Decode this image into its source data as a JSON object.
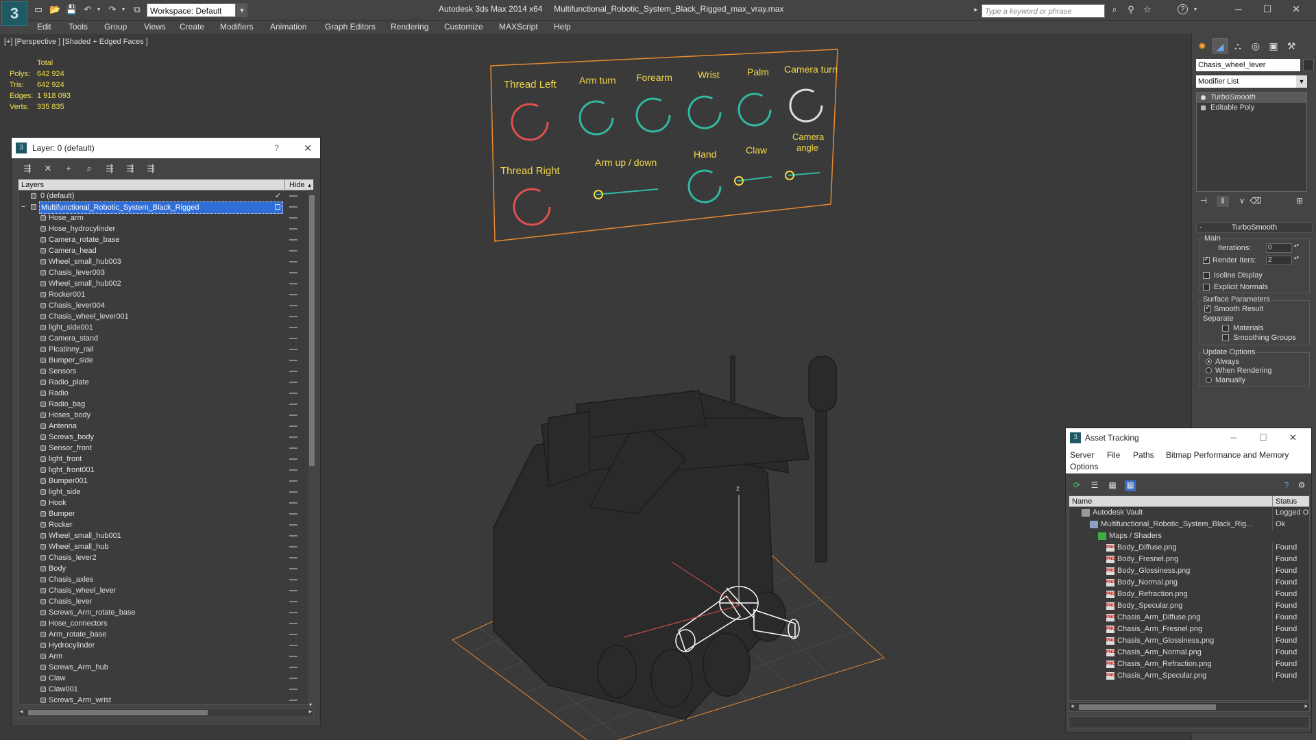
{
  "app": {
    "title": "Autodesk 3ds Max 2014 x64",
    "filename": "Multifunctional_Robotic_System_Black_Rigged_max_vray.max",
    "workspace": "Workspace: Default",
    "search_placeholder": "Type a keyword or phrase",
    "logo_glyph": "3"
  },
  "menu": [
    "Edit",
    "Tools",
    "Group",
    "Views",
    "Create",
    "Modifiers",
    "Animation",
    "Graph Editors",
    "Rendering",
    "Customize",
    "MAXScript",
    "Help"
  ],
  "viewport": {
    "label": "[+] [Perspective ] [Shaded + Edged Faces ]",
    "stats": {
      "header": "Total",
      "rows": [
        {
          "k": "Polys:",
          "v": "642 924"
        },
        {
          "k": "Tris:",
          "v": "642 924"
        },
        {
          "k": "Edges:",
          "v": "1 918 093"
        },
        {
          "k": "Verts:",
          "v": "335 835"
        }
      ]
    },
    "panel_labels": {
      "thread_left": "Thread Left",
      "arm_turn": "Arm turn",
      "forearm": "Forearm",
      "wrist": "Wrist",
      "palm": "Palm",
      "camera_turn": "Camera turn",
      "thread_right": "Thread Right",
      "arm_up_down": "Arm up / down",
      "hand": "Hand",
      "claw": "Claw",
      "camera_angle_1": "Camera",
      "camera_angle_2": "angle"
    },
    "axis_z": "z",
    "accent_red": "#e05050",
    "accent_teal": "#30b8a0",
    "accent_yellow": "#f2d84a",
    "accent_orange": "#e88a30"
  },
  "layer_dialog": {
    "title": "Layer: 0 (default)",
    "help": "?",
    "close": "✕",
    "col_layers": "Layers",
    "col_hide": "Hide",
    "col_hide_arrow": "▲",
    "tools": [
      "⇶",
      "✕",
      "+",
      "⌕",
      "⇶",
      "⇶",
      "⇶"
    ],
    "default_layer": "0 (default)",
    "selected_layer": "Multifunctional_Robotic_System_Black_Rigged",
    "checkmark": "✓",
    "expand": "−",
    "items": [
      "Hose_arm",
      "Hose_hydrocylinder",
      "Camera_rotate_base",
      "Camera_head",
      "Wheel_small_hub003",
      "Chasis_lever003",
      "Wheel_small_hub002",
      "Rocker001",
      "Chasis_lever004",
      "Chasis_wheel_lever001",
      "light_side001",
      "Camera_stand",
      "Picatinny_rail",
      "Bumper_side",
      "Sensors",
      "Radio_plate",
      "Radio",
      "Radio_bag",
      "Hoses_body",
      "Antenna",
      "Screws_body",
      "Sensor_front",
      "light_front",
      "light_front001",
      "Bumper001",
      "light_side",
      "Hook",
      "Bumper",
      "Rocker",
      "Wheel_small_hub001",
      "Wheel_small_hub",
      "Chasis_lever2",
      "Body",
      "Chasis_axles",
      "Chasis_wheel_lever",
      "Chasis_lever",
      "Screws_Arm_rotate_base",
      "Hose_connectors",
      "Arm_rotate_base",
      "Hydrocylinder",
      "Arm",
      "Screws_Arm_hub",
      "Claw",
      "Claw001",
      "Screws_Arm_wrist"
    ],
    "scroll_left": "◂",
    "scroll_right": "▸",
    "scroll_down": "▾",
    "scroll_up": "▴"
  },
  "command_panel": {
    "tabs": [
      "✹",
      "◢",
      "⛬",
      "◎",
      "▣",
      "⚒"
    ],
    "object_name": "Chasis_wheel_lever",
    "modifier_list": "Modifier List",
    "dropdown_arrow": "▼",
    "stack": [
      "TurboSmooth",
      "Editable Poly"
    ],
    "stack_tools": [
      "⊣",
      "‖",
      "⋎",
      "⌫",
      "⊞"
    ],
    "rollout_title": "TurboSmooth",
    "rollout_toggle": "-",
    "main": "Main",
    "iterations_label": "Iterations:",
    "iterations_value": "0",
    "render_iters_label": "Render Iters:",
    "render_iters_value": "2",
    "isoline": "Isoline Display",
    "explicit_normals": "Explicit Normals",
    "surface_params": "Surface Parameters",
    "smooth_result": "Smooth Result",
    "separate": "Separate",
    "materials": "Materials",
    "smoothing_groups": "Smoothing Groups",
    "update_options": "Update Options",
    "always": "Always",
    "when_rendering": "When Rendering",
    "manually": "Manually"
  },
  "asset_tracking": {
    "title": "Asset Tracking",
    "minimize": "─",
    "maximize": "☐",
    "close": "✕",
    "menu": [
      "Server",
      "File",
      "Paths",
      "Bitmap Performance and Memory",
      "Options"
    ],
    "tools": [
      "⟳",
      "☰",
      "▦",
      "▦"
    ],
    "help_icons": [
      "?",
      "⚙"
    ],
    "col_name": "Name",
    "col_status": "Status",
    "png_label": "PNG",
    "rows": [
      {
        "name": "Autodesk Vault",
        "status": "Logged O",
        "indent": 0,
        "kind": "vault"
      },
      {
        "name": "Multifunctional_Robotic_System_Black_Rig...",
        "status": "Ok",
        "indent": 1,
        "kind": "file"
      },
      {
        "name": "Maps / Shaders",
        "status": "",
        "indent": 2,
        "kind": "folder"
      },
      {
        "name": "Body_Diffuse.png",
        "status": "Found",
        "indent": 3,
        "kind": "png"
      },
      {
        "name": "Body_Fresnel.png",
        "status": "Found",
        "indent": 3,
        "kind": "png"
      },
      {
        "name": "Body_Glossiness.png",
        "status": "Found",
        "indent": 3,
        "kind": "png"
      },
      {
        "name": "Body_Normal.png",
        "status": "Found",
        "indent": 3,
        "kind": "png"
      },
      {
        "name": "Body_Refraction.png",
        "status": "Found",
        "indent": 3,
        "kind": "png"
      },
      {
        "name": "Body_Specular.png",
        "status": "Found",
        "indent": 3,
        "kind": "png"
      },
      {
        "name": "Chasis_Arm_Diffuse.png",
        "status": "Found",
        "indent": 3,
        "kind": "png"
      },
      {
        "name": "Chasis_Arm_Fresnel.png",
        "status": "Found",
        "indent": 3,
        "kind": "png"
      },
      {
        "name": "Chasis_Arm_Glossiness.png",
        "status": "Found",
        "indent": 3,
        "kind": "png"
      },
      {
        "name": "Chasis_Arm_Normal.png",
        "status": "Found",
        "indent": 3,
        "kind": "png"
      },
      {
        "name": "Chasis_Arm_Refraction.png",
        "status": "Found",
        "indent": 3,
        "kind": "png"
      },
      {
        "name": "Chasis_Arm_Specular.png",
        "status": "Found",
        "indent": 3,
        "kind": "png"
      }
    ]
  },
  "window_buttons": {
    "minimize": "─",
    "maximize": "☐",
    "close": "✕"
  },
  "quick_access": [
    "▭",
    "📂",
    "💾",
    "↶",
    "▾",
    "↷",
    "▾",
    "⧉"
  ],
  "info_icons": [
    "▸",
    "⌕",
    "⚲",
    "☆",
    "?",
    "▾"
  ]
}
